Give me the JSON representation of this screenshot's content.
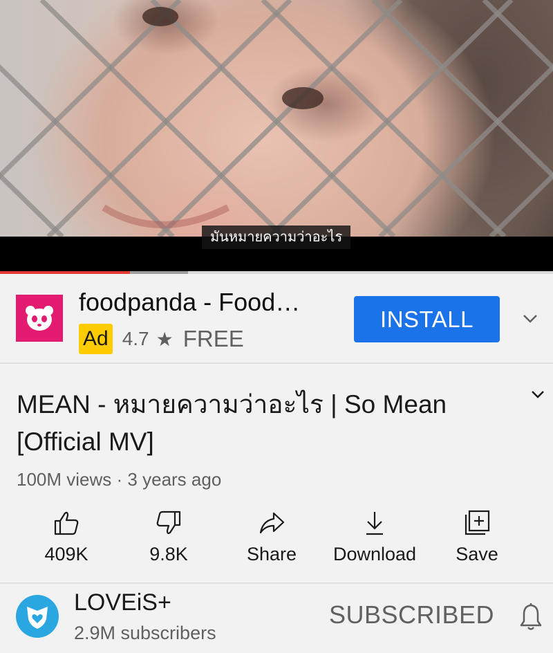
{
  "player": {
    "caption": "มันหมายความว่าอะไร",
    "progress_played": 0.235,
    "progress_buffered": 0.34
  },
  "ad": {
    "app_name": "foodpanda - Food…",
    "badge": "Ad",
    "rating": "4.7",
    "rating_star": "★",
    "price": "FREE",
    "install_label": "INSTALL",
    "logo_icon": "foodpanda-logo-icon",
    "brand_color": "#e21b70",
    "button_color": "#1a73e8",
    "badge_color": "#ffcc00"
  },
  "video": {
    "title": "MEAN - หมายความว่าอะไร | So Mean [Official MV]",
    "views": "100M views",
    "separator": "·",
    "age": "3 years ago"
  },
  "actions": [
    {
      "id": "like",
      "label": "409K",
      "icon": "thumbs-up-icon"
    },
    {
      "id": "dislike",
      "label": "9.8K",
      "icon": "thumbs-down-icon"
    },
    {
      "id": "share",
      "label": "Share",
      "icon": "share-arrow-icon"
    },
    {
      "id": "download",
      "label": "Download",
      "icon": "download-icon"
    },
    {
      "id": "save",
      "label": "Save",
      "icon": "add-to-playlist-icon"
    }
  ],
  "channel": {
    "name": "LOVEiS+",
    "subscribers": "2.9M subscribers",
    "subscribe_label": "SUBSCRIBED",
    "avatar_color": "#2aa7e0"
  }
}
